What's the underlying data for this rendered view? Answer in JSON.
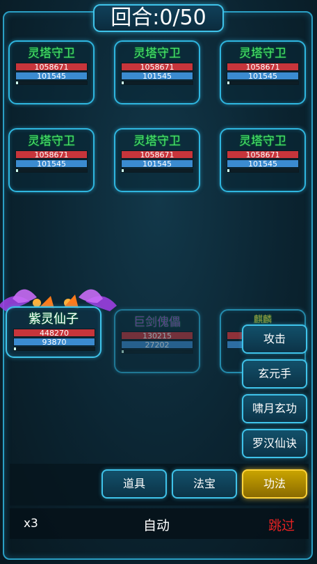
{
  "round": {
    "label": "回合:0/50"
  },
  "enemies": [
    {
      "name": "灵塔守卫",
      "hp": "1058671",
      "mp": "101545"
    },
    {
      "name": "灵塔守卫",
      "hp": "1058671",
      "mp": "101545"
    },
    {
      "name": "灵塔守卫",
      "hp": "1058671",
      "mp": "101545"
    },
    {
      "name": "灵塔守卫",
      "hp": "1058671",
      "mp": "101545"
    },
    {
      "name": "灵塔守卫",
      "hp": "1058671",
      "mp": "101545"
    },
    {
      "name": "灵塔守卫",
      "hp": "1058671",
      "mp": "101545"
    }
  ],
  "allies": [
    {
      "name": "紫灵仙子",
      "hp": "448270",
      "mp": "93870"
    },
    {
      "name": "巨剑傀儡",
      "hp": "130215",
      "mp": "27202"
    },
    {
      "name": "麒麟"
    }
  ],
  "skills": [
    "攻击",
    "玄元手",
    "啸月玄功",
    "罗汉仙诀"
  ],
  "tabs": [
    "道具",
    "法宝",
    "功法"
  ],
  "footer": {
    "speed": "x3",
    "auto": "自动",
    "skip": "跳过"
  },
  "colors": {
    "accent": "#3fc3ea",
    "active_tab": "#c9a400",
    "enemy_name": "#4ee36a",
    "hp": "#c7353b",
    "mp": "#3b8bd0",
    "skip": "#e52222"
  }
}
